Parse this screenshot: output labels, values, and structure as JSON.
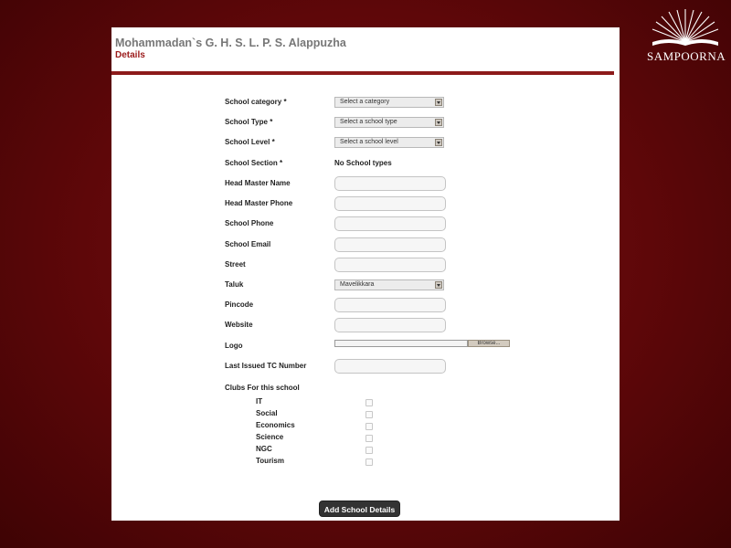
{
  "brand": {
    "name": "SAMPOORNA",
    "icon": "book-rays-icon"
  },
  "header": {
    "school_name": "Mohammadan`s G. H. S. L. P. S. Alappuzha",
    "subtitle": "Details"
  },
  "form": {
    "school_category": {
      "label": "School category *",
      "value": "Select a category"
    },
    "school_type": {
      "label": "School Type *",
      "value": "Select a school type"
    },
    "school_level": {
      "label": "School Level *",
      "value": "Select a school level"
    },
    "school_section": {
      "label": "School Section *",
      "value": "No School types"
    },
    "head_master_name": {
      "label": "Head Master Name",
      "value": ""
    },
    "head_master_phone": {
      "label": "Head Master Phone",
      "value": ""
    },
    "school_phone": {
      "label": "School Phone",
      "value": ""
    },
    "school_email": {
      "label": "School Email",
      "value": ""
    },
    "street": {
      "label": "Street",
      "value": ""
    },
    "taluk": {
      "label": "Taluk",
      "value": "Mavelikkara"
    },
    "pincode": {
      "label": "Pincode",
      "value": ""
    },
    "website": {
      "label": "Website",
      "value": ""
    },
    "logo": {
      "label": "Logo",
      "browse": "Browse..."
    },
    "last_tc": {
      "label": "Last Issued TC Number",
      "value": ""
    },
    "clubs": {
      "label": "Clubs For this school",
      "items": [
        {
          "name": "IT",
          "checked": false
        },
        {
          "name": "Social",
          "checked": false
        },
        {
          "name": "Economics",
          "checked": false
        },
        {
          "name": "Science",
          "checked": false
        },
        {
          "name": "NGC",
          "checked": false
        },
        {
          "name": "Tourism",
          "checked": false
        }
      ]
    },
    "submit_label": "Add School Details"
  },
  "colors": {
    "background": "#6b0a0d",
    "accent": "#8c1a1a",
    "subtitle": "#9b1a1a",
    "button": "#333333"
  }
}
